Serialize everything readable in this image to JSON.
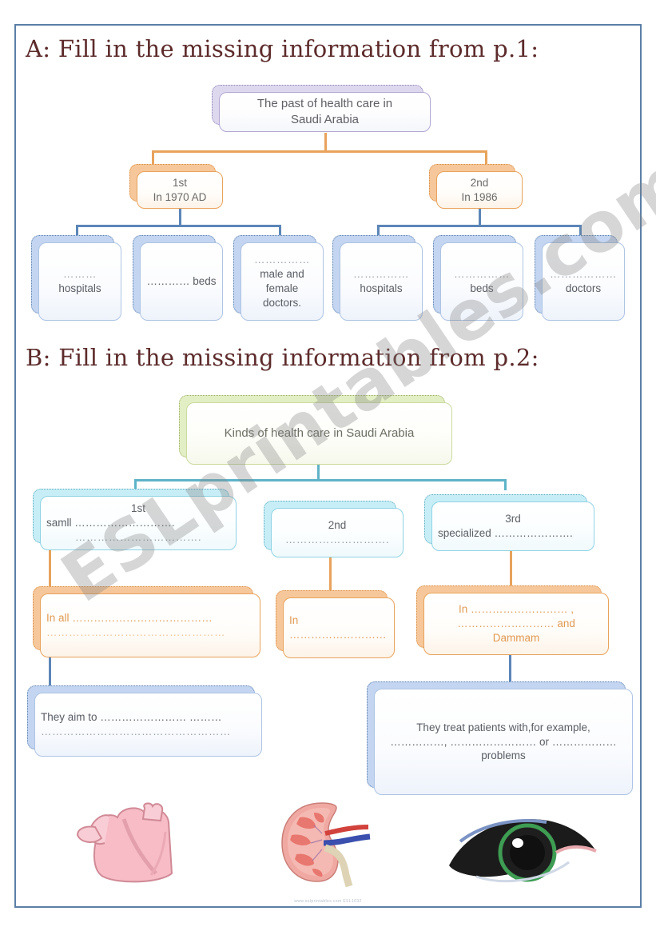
{
  "page": {
    "watermark": "ESLprintables.com",
    "footer": "www.eslprintables.com    ESL1032"
  },
  "section_a": {
    "heading": "A: Fill in the missing information from p.1:",
    "root": {
      "line1": "The past of health care in",
      "line2": "Saudi Arabia"
    },
    "branches": [
      {
        "label": "1st",
        "year": "In 1970 AD",
        "children": [
          {
            "line1": "………",
            "line2": "hospitals"
          },
          {
            "line1": "………… beds",
            "line2": ""
          },
          {
            "line1": "……………",
            "line2": "male and",
            "line3": "female",
            "line4": "doctors."
          }
        ]
      },
      {
        "label": "2nd",
        "year": "In 1986",
        "children": [
          {
            "line1": "……………",
            "line2": "hospitals"
          },
          {
            "line1": "……………",
            "line2": "beds"
          },
          {
            "line1": "………………",
            "line2": "doctors"
          }
        ]
      }
    ]
  },
  "section_b": {
    "heading": "B: Fill in the missing information from p.2:",
    "root": "Kinds of health care in Saudi Arabia",
    "kinds": [
      {
        "label": "1st",
        "line1": "samll ……………………….",
        "line2": "……………………………."
      },
      {
        "label": "2nd",
        "line1": "……………………….",
        "line2": ""
      },
      {
        "label": "3rd",
        "line1": "specialized ………………….",
        "line2": ""
      }
    ],
    "locations": [
      {
        "line1": "In all …………………………………",
        "line2": "…………………………………………"
      },
      {
        "line1": "In ………………………",
        "line2": ""
      },
      {
        "line1": "In ……………………… ,",
        "line2": "……………………… and",
        "line3": "Dammam"
      }
    ],
    "outcomes": [
      {
        "line1": "They aim to ……………………  ………",
        "line2": "……………………………………………"
      },
      {
        "line1": "They treat patients with,for example,",
        "line2": "……………,  …………………… or ………………",
        "line3": "problems"
      }
    ]
  },
  "illustrations": [
    {
      "name": "heart-illustration"
    },
    {
      "name": "kidney-illustration"
    },
    {
      "name": "eye-illustration"
    }
  ]
}
